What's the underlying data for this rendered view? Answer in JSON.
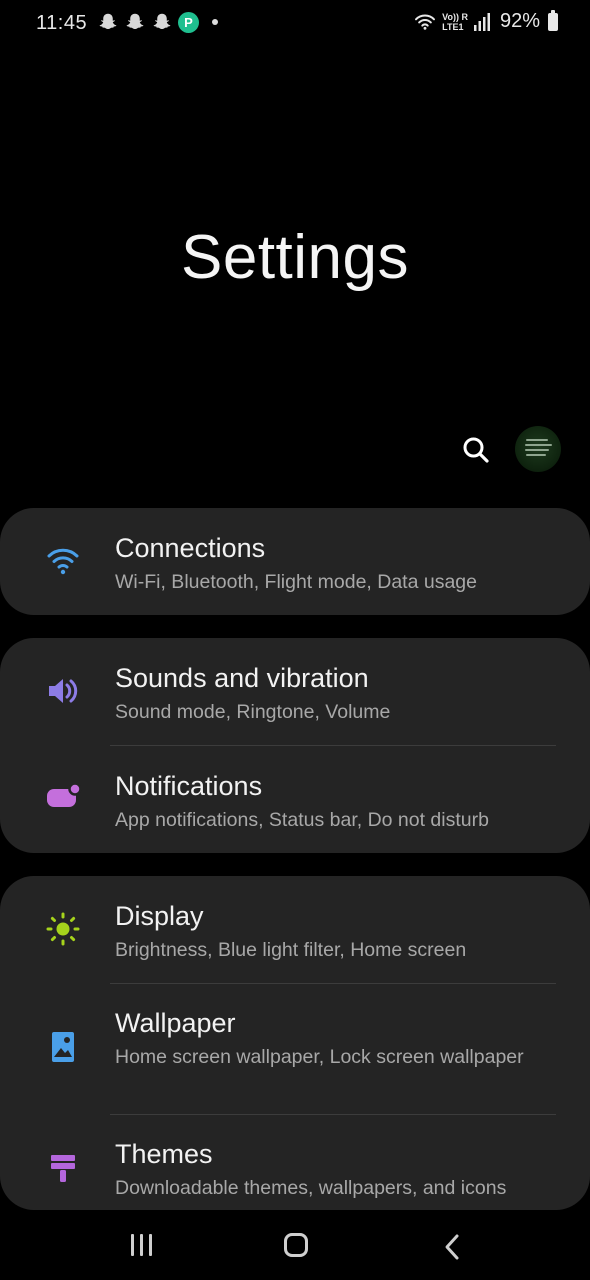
{
  "status_bar": {
    "time": "11:45",
    "net_line1": "Vo)) R",
    "net_line2": "LTE1",
    "battery": "92%",
    "app_badge_letter": "P",
    "left_icons": [
      "snapchat-icon",
      "snapchat-icon",
      "snapchat-icon",
      "app-p-icon",
      "dot-icon"
    ],
    "right_icons": [
      "wifi-icon",
      "signal-icon",
      "battery-icon"
    ]
  },
  "header": {
    "title": "Settings"
  },
  "toolbar": {
    "search_icon": "search-icon",
    "avatar": "profile-avatar"
  },
  "groups": [
    {
      "items": [
        {
          "title": "Connections",
          "subtitle": "Wi-Fi, Bluetooth, Flight mode, Data usage",
          "icon": "wifi-icon",
          "color": "#4a9fe8"
        }
      ]
    },
    {
      "items": [
        {
          "title": "Sounds and vibration",
          "subtitle": "Sound mode, Ringtone, Volume",
          "icon": "volume-icon",
          "color": "#8d7ce6"
        },
        {
          "title": "Notifications",
          "subtitle": "App notifications, Status bar, Do not disturb",
          "icon": "notification-icon",
          "color": "#c46fdc"
        }
      ]
    },
    {
      "items": [
        {
          "title": "Display",
          "subtitle": "Brightness, Blue light filter, Home screen",
          "icon": "sun-icon",
          "color": "#a6d31c"
        },
        {
          "title": "Wallpaper",
          "subtitle": "Home screen wallpaper, Lock screen wallpaper",
          "icon": "image-icon",
          "color": "#4a9fe8"
        },
        {
          "title": "Themes",
          "subtitle": "Downloadable themes, wallpapers, and icons",
          "icon": "paint-brush-icon",
          "color": "#b466dc"
        }
      ]
    }
  ],
  "nav_bar": {
    "items": [
      "recent-apps-icon",
      "home-icon",
      "back-icon"
    ]
  }
}
